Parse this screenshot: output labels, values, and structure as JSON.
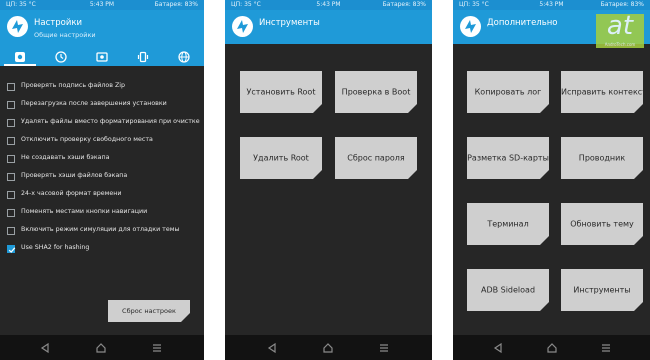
{
  "status": {
    "cpu": "ЦП: 35 °C",
    "time": "5:43 PM",
    "battery": "Батарея: 83%"
  },
  "settings": {
    "title": "Настройки",
    "subtitle": "Общие настройки",
    "tabs": [
      "settings-tab",
      "clock-tab",
      "display-tab",
      "vibration-tab",
      "language-tab"
    ],
    "options": [
      {
        "label": "Проверять подпись файлов Zip",
        "checked": false
      },
      {
        "label": "Перезагрузка после завершения установки",
        "checked": false
      },
      {
        "label": "Удалять файлы вместо форматирования при очистке",
        "checked": false
      },
      {
        "label": "Отключить проверку свободного места",
        "checked": false
      },
      {
        "label": "Не создавать хэши бэкапа",
        "checked": false
      },
      {
        "label": "Проверять хэши файлов бэкапа",
        "checked": false
      },
      {
        "label": "24-х часовой формат времени",
        "checked": false
      },
      {
        "label": "Поменять местами кнопки навигации",
        "checked": false
      },
      {
        "label": "Включить режим симуляции для отладки темы",
        "checked": false
      },
      {
        "label": "Use SHA2 for hashing",
        "checked": true
      }
    ],
    "reset_label": "Сброс настроек"
  },
  "tools": {
    "title": "Инструменты",
    "buttons": [
      "Установить Root",
      "Проверка в Boot",
      "Удалить Root",
      "Сброс пароля"
    ]
  },
  "advanced": {
    "title": "Дополнительно",
    "buttons": [
      "Копировать лог",
      "Исправить контекст",
      "Разметка SD-карты",
      "Проводник",
      "Терминал",
      "Обновить тему",
      "ADB Sideload",
      "Инструменты"
    ]
  },
  "watermark": {
    "text": "at",
    "sub": "AndroTech.com"
  },
  "colors": {
    "accent": "#1f9ad8",
    "background": "#262626",
    "button": "#cfcfcf"
  }
}
